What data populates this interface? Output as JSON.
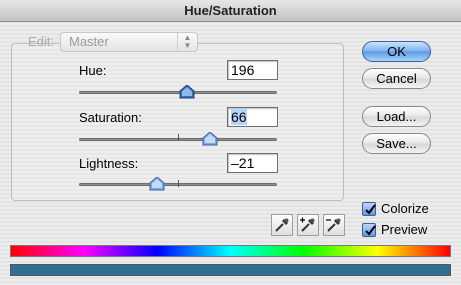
{
  "window": {
    "title": "Hue/Saturation"
  },
  "edit": {
    "label": "Edit:",
    "value": "Master"
  },
  "hue": {
    "label": "Hue:",
    "value": "196",
    "slider_fraction": 0.544,
    "thumb_color": "#3a6fb8"
  },
  "saturation": {
    "label": "Saturation:",
    "value": "66",
    "slider_fraction": 0.66
  },
  "lightness": {
    "label": "Lightness:",
    "value": "–21",
    "slider_fraction": 0.395
  },
  "buttons": {
    "ok": "OK",
    "cancel": "Cancel",
    "load": "Load...",
    "save": "Save..."
  },
  "options": {
    "colorize": {
      "label": "Colorize",
      "checked": true
    },
    "preview": {
      "label": "Preview",
      "checked": true
    }
  },
  "tools": [
    "eyedropper-icon",
    "eyedropper-plus-icon",
    "eyedropper-minus-icon"
  ],
  "colors": {
    "result_bar": "#2f6f92",
    "accent": "#5a9ae4"
  }
}
